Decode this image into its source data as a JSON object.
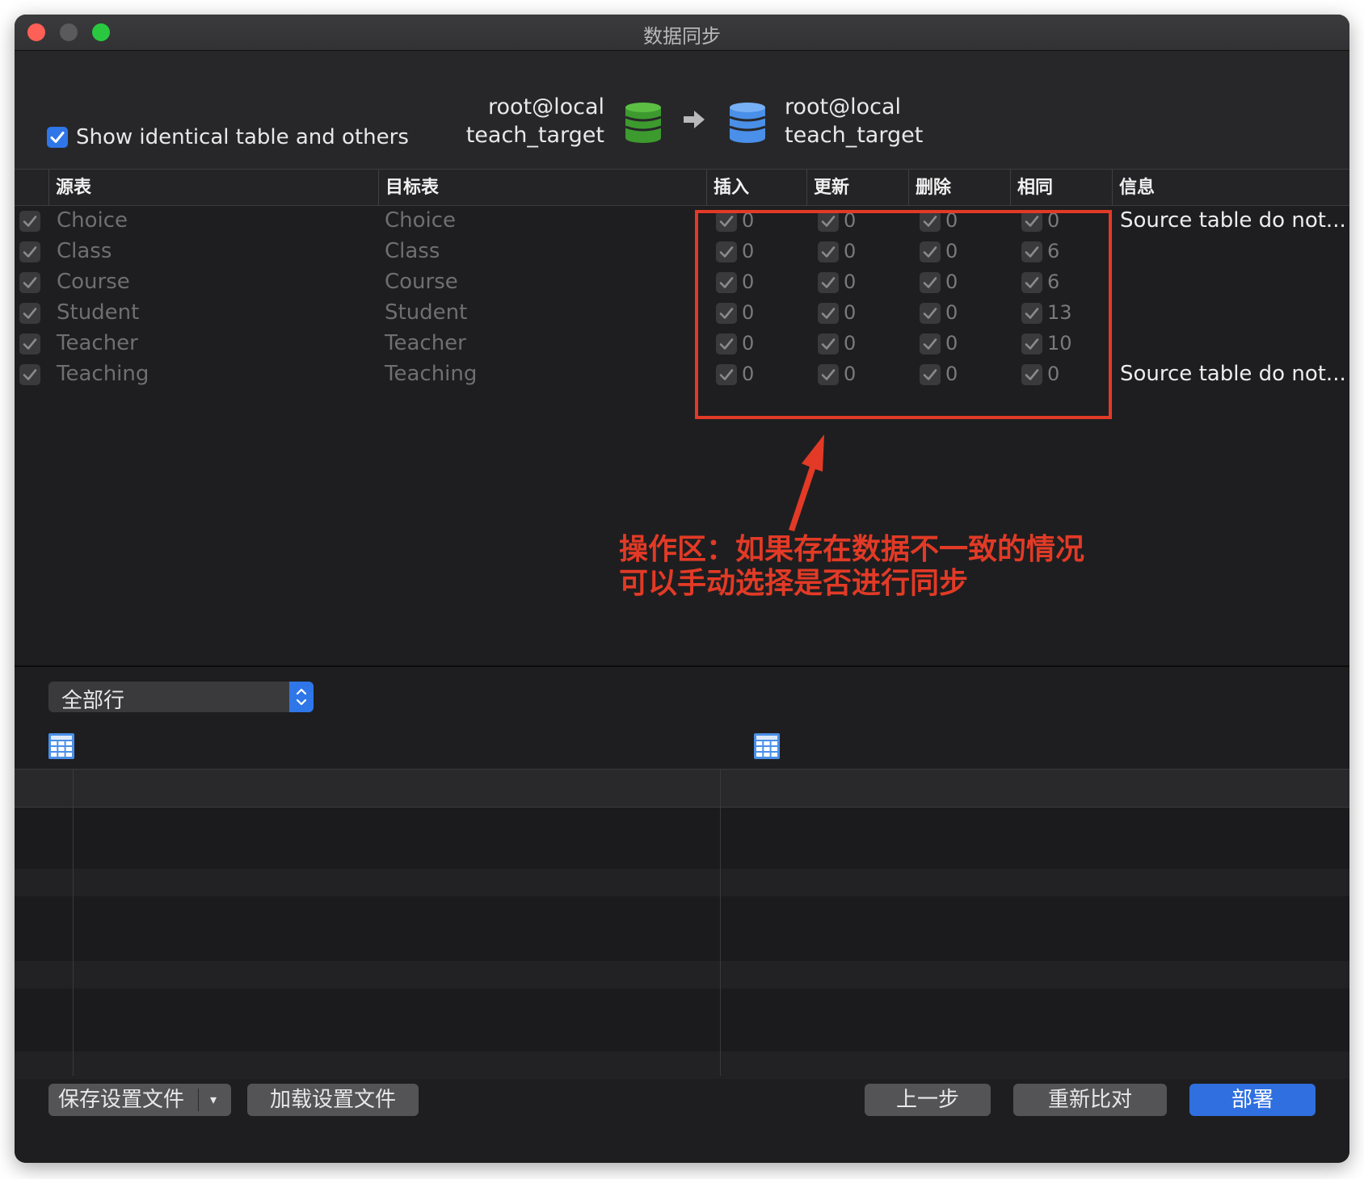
{
  "window": {
    "title": "数据同步"
  },
  "top": {
    "show_identical_label": "Show identical table and others",
    "source": {
      "user": "root@local",
      "database": "teach_target"
    },
    "target": {
      "user": "root@local",
      "database": "teach_target"
    }
  },
  "columns": {
    "source": "源表",
    "target": "目标表",
    "insert": "插入",
    "update": "更新",
    "delete": "删除",
    "same": "相同",
    "info": "信息"
  },
  "rows": [
    {
      "source": "Choice",
      "target": "Choice",
      "insert": "0",
      "update": "0",
      "delete": "0",
      "same": "0",
      "info": "Source table do not..."
    },
    {
      "source": "Class",
      "target": "Class",
      "insert": "0",
      "update": "0",
      "delete": "0",
      "same": "6",
      "info": ""
    },
    {
      "source": "Course",
      "target": "Course",
      "insert": "0",
      "update": "0",
      "delete": "0",
      "same": "6",
      "info": ""
    },
    {
      "source": "Student",
      "target": "Student",
      "insert": "0",
      "update": "0",
      "delete": "0",
      "same": "13",
      "info": ""
    },
    {
      "source": "Teacher",
      "target": "Teacher",
      "insert": "0",
      "update": "0",
      "delete": "0",
      "same": "10",
      "info": ""
    },
    {
      "source": "Teaching",
      "target": "Teaching",
      "insert": "0",
      "update": "0",
      "delete": "0",
      "same": "0",
      "info": "Source table do not..."
    }
  ],
  "annotation": {
    "line1": "操作区：如果存在数据不一致的情况",
    "line2": "可以手动选择是否进行同步"
  },
  "lower": {
    "row_filter": "全部行"
  },
  "buttons": {
    "save_settings": "保存设置文件",
    "load_settings": "加载设置文件",
    "previous": "上一步",
    "recompare": "重新比对",
    "deploy": "部署"
  },
  "colors": {
    "accent": "#2f76e8",
    "annotation": "#e23a26",
    "source_db": "#3d9a2e",
    "target_db": "#4a8fe8"
  }
}
